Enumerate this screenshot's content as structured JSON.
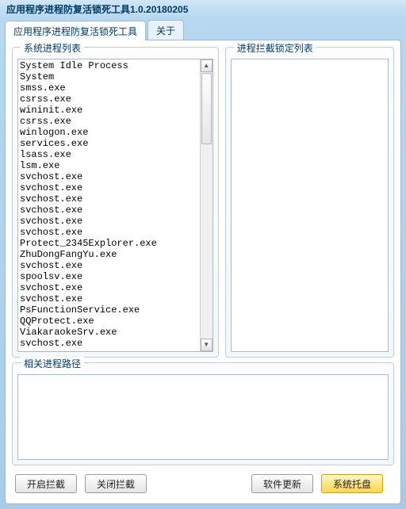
{
  "window": {
    "title": "应用程序进程防复活锁死工具1.0.20180205"
  },
  "tabs": {
    "main": "应用程序进程防复活锁死工具",
    "about": "关于"
  },
  "groups": {
    "processList": "系统进程列表",
    "lockList": "进程拦截锁定列表",
    "pathList": "相关进程路径"
  },
  "buttons": {
    "startBlock": "开启拦截",
    "stopBlock": "关闭拦截",
    "update": "软件更新",
    "tray": "系统托盘"
  },
  "processes": [
    "System Idle Process",
    "System",
    "smss.exe",
    "csrss.exe",
    "wininit.exe",
    "csrss.exe",
    "winlogon.exe",
    "services.exe",
    "lsass.exe",
    "lsm.exe",
    "svchost.exe",
    "svchost.exe",
    "svchost.exe",
    "svchost.exe",
    "svchost.exe",
    "svchost.exe",
    "Protect_2345Explorer.exe",
    "ZhuDongFangYu.exe",
    "svchost.exe",
    "spoolsv.exe",
    "svchost.exe",
    "svchost.exe",
    "PsFunctionService.exe",
    "QQProtect.exe",
    "ViakaraokeSrv.exe",
    "svchost.exe"
  ],
  "lockedProcesses": [],
  "paths": []
}
